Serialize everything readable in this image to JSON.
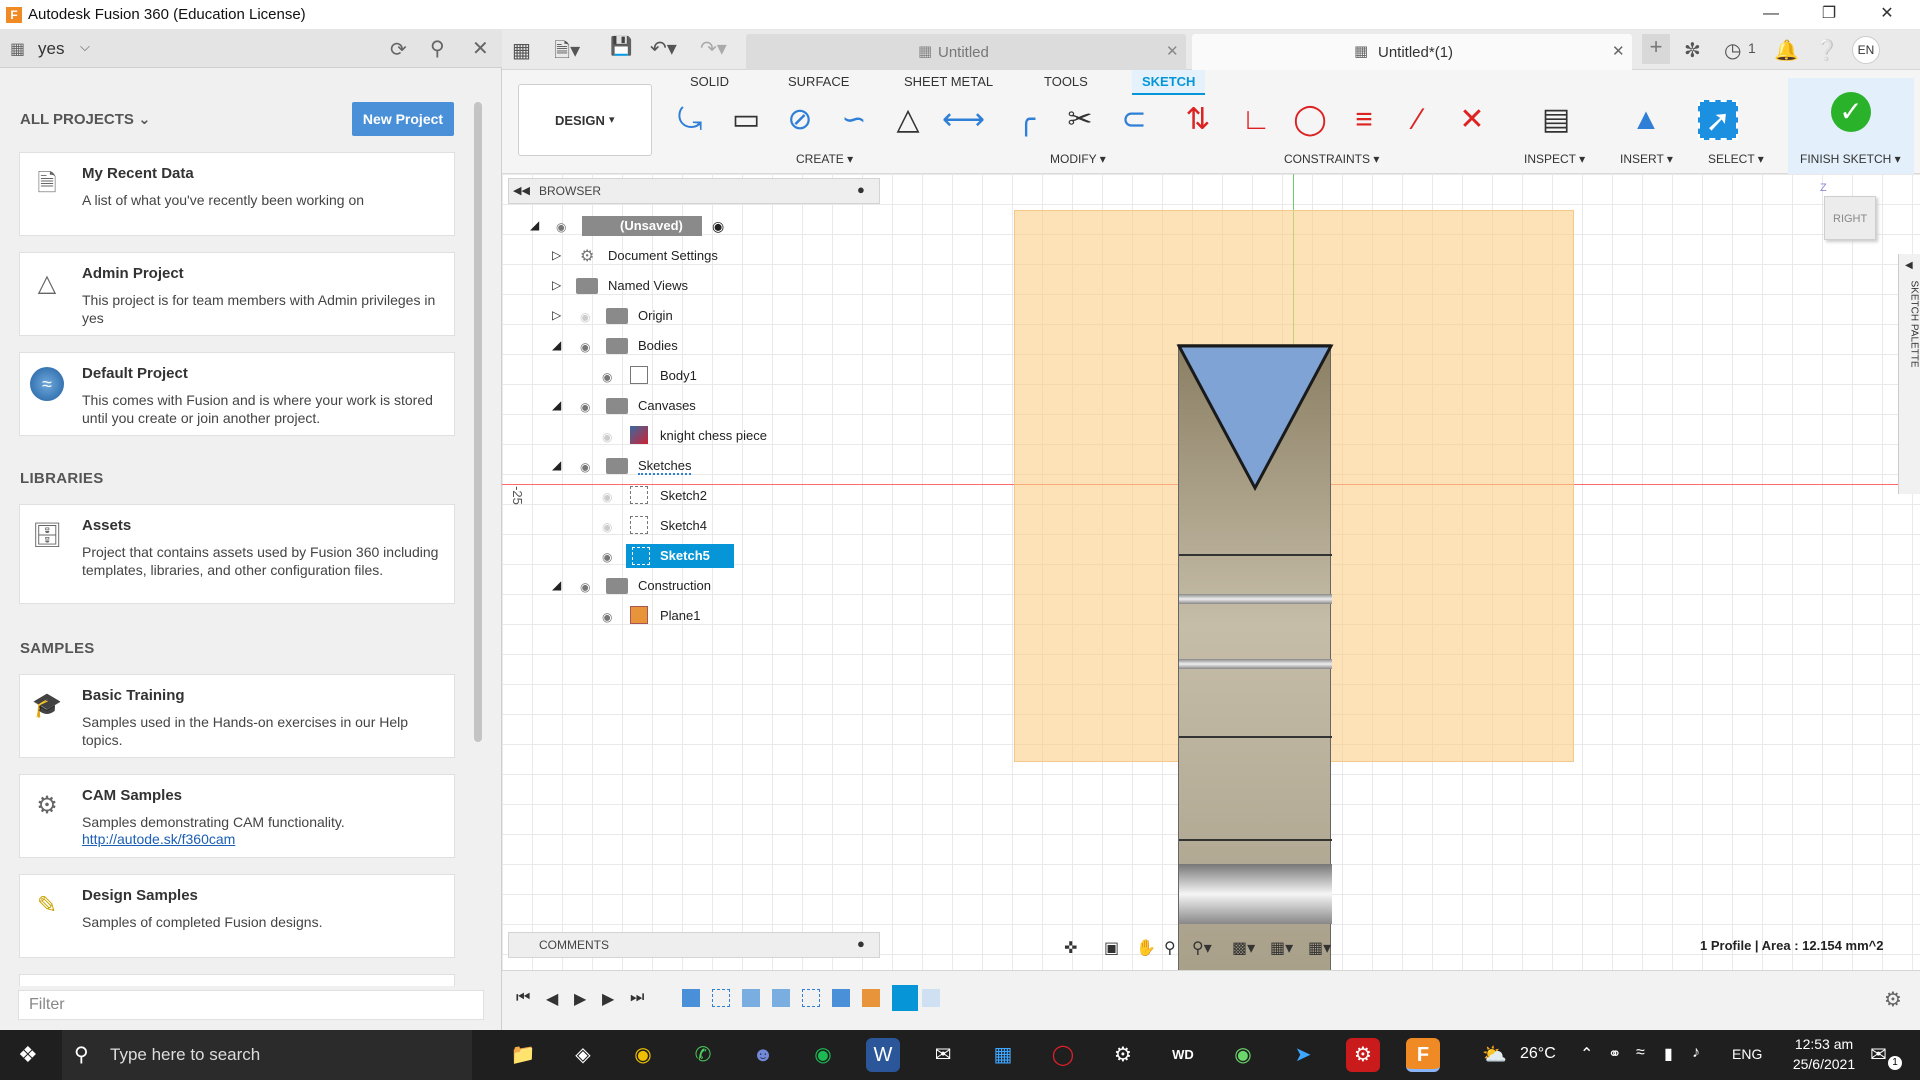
{
  "window": {
    "title": "Autodesk Fusion 360 (Education License)"
  },
  "left_panel": {
    "team": "yes",
    "all_projects_label": "ALL PROJECTS",
    "new_project_label": "New Project",
    "projects": [
      {
        "title": "My Recent Data",
        "desc": "A list of what you've recently been working on",
        "icon": "recent-data-icon"
      },
      {
        "title": "Admin Project",
        "desc": "This project is for team members with Admin privileges in yes",
        "icon": "admin-icon"
      },
      {
        "title": "Default Project",
        "desc": "This comes with Fusion and is where your work is stored until you create or join another project.",
        "icon": "default-project-icon"
      }
    ],
    "libraries_label": "LIBRARIES",
    "libraries": [
      {
        "title": "Assets",
        "desc": "Project that contains assets used by Fusion 360 including templates, libraries, and other configuration files.",
        "icon": "assets-icon"
      }
    ],
    "samples_label": "SAMPLES",
    "samples": [
      {
        "title": "Basic Training",
        "desc": "Samples used in the Hands-on exercises in our Help topics.",
        "icon": "training-icon"
      },
      {
        "title": "CAM Samples",
        "desc": "Samples demonstrating CAM functionality.",
        "link": "http://autode.sk/f360cam",
        "icon": "cam-icon"
      },
      {
        "title": "Design Samples",
        "desc": "Samples of completed Fusion designs.",
        "icon": "design-samples-icon"
      }
    ],
    "filter_placeholder": "Filter"
  },
  "doc_tabs": [
    {
      "label": "Untitled",
      "active": false
    },
    {
      "label": "Untitled*(1)",
      "active": true
    }
  ],
  "appbar_right": {
    "jobs_count": "1",
    "user_initials": "EN"
  },
  "toolbar": {
    "workspace": "DESIGN",
    "tabs": [
      "SOLID",
      "SURFACE",
      "SHEET METAL",
      "TOOLS",
      "SKETCH"
    ],
    "active_tab": "SKETCH",
    "groups": {
      "create": "CREATE",
      "modify": "MODIFY",
      "constraints": "CONSTRAINTS",
      "inspect": "INSPECT",
      "insert": "INSERT",
      "select": "SELECT",
      "finish": "FINISH SKETCH"
    }
  },
  "browser": {
    "title": "BROWSER",
    "root": "(Unsaved)",
    "nodes": [
      {
        "label": "Document Settings"
      },
      {
        "label": "Named Views"
      },
      {
        "label": "Origin"
      },
      {
        "label": "Bodies"
      },
      {
        "label": "Body1"
      },
      {
        "label": "Canvases"
      },
      {
        "label": "knight chess piece"
      },
      {
        "label": "Sketches"
      },
      {
        "label": "Sketch2"
      },
      {
        "label": "Sketch4"
      },
      {
        "label": "Sketch5"
      },
      {
        "label": "Construction"
      },
      {
        "label": "Plane1"
      }
    ]
  },
  "viewport": {
    "axis_label": "-25",
    "viewcube_face": "RIGHT",
    "sketch_palette_label": "SKETCH PALETTE",
    "comments_label": "COMMENTS",
    "status": "1 Profile | Area : 12.154 mm^2"
  },
  "taskbar": {
    "search_placeholder": "Type here to search",
    "weather": "26°C",
    "lang": "ENG",
    "time": "12:53 am",
    "date": "25/6/2021",
    "notifications": "1"
  }
}
